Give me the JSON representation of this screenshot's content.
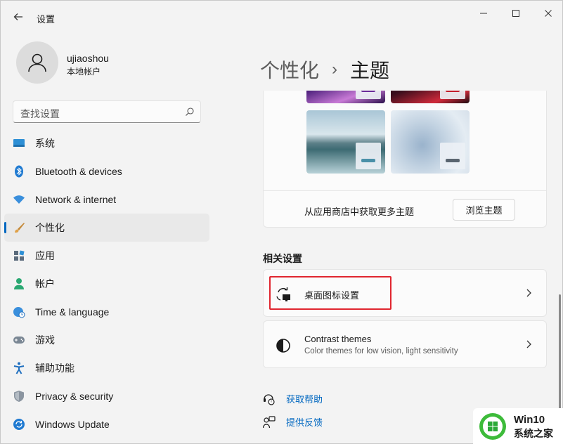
{
  "window": {
    "title": "设置",
    "minimize_glyph": "—",
    "maximize_glyph": "☐",
    "close_glyph": "✕"
  },
  "profile": {
    "name": "ujiaoshou",
    "account_type": "本地帐户"
  },
  "search": {
    "placeholder": "查找设置"
  },
  "sidebar": {
    "items": [
      {
        "label": "系统",
        "icon": "system-icon"
      },
      {
        "label": "Bluetooth & devices",
        "icon": "bluetooth-icon"
      },
      {
        "label": "Network & internet",
        "icon": "wifi-icon"
      },
      {
        "label": "个性化",
        "icon": "brush-icon",
        "active": true
      },
      {
        "label": "应用",
        "icon": "apps-icon"
      },
      {
        "label": "帐户",
        "icon": "account-icon"
      },
      {
        "label": "Time & language",
        "icon": "globe-clock-icon"
      },
      {
        "label": "游戏",
        "icon": "gamepad-icon"
      },
      {
        "label": "辅助功能",
        "icon": "accessibility-icon"
      },
      {
        "label": "Privacy & security",
        "icon": "shield-icon"
      },
      {
        "label": "Windows Update",
        "icon": "update-icon"
      }
    ]
  },
  "breadcrumb": {
    "parent": "个性化",
    "separator": "›",
    "current": "主题"
  },
  "themes": {
    "store_text": "从应用商店中获取更多主题",
    "browse_label": "浏览主题"
  },
  "related": {
    "heading": "相关设置",
    "desktop_icons": {
      "title": "桌面图标设置"
    },
    "contrast": {
      "title": "Contrast themes",
      "subtitle": "Color themes for low vision, light sensitivity"
    }
  },
  "links": {
    "help": "获取帮助",
    "feedback": "提供反馈"
  },
  "watermark": {
    "line1": "Win10",
    "line2": "系统之家"
  },
  "colors": {
    "accent": "#0067c0",
    "highlight_box": "#e0262f"
  }
}
